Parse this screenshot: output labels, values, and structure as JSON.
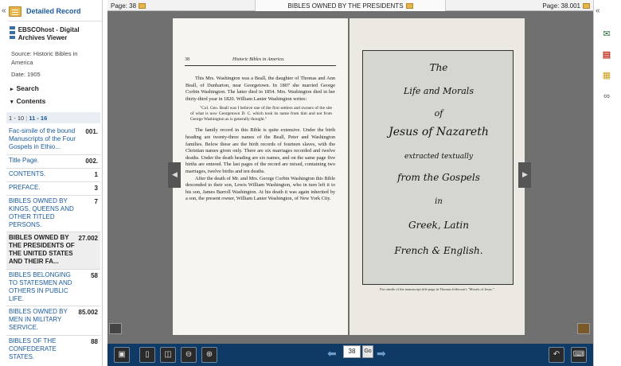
{
  "sidebar": {
    "collapse_glyph": "«",
    "title": "Detailed Record",
    "viewer_title": "EBSCOhost - Digital Archives Viewer",
    "source": "Source: Historic Bibles in America",
    "date": "Date: 1905",
    "search_label": "Search",
    "contents_label": "Contents",
    "range_current": "1 - 10",
    "range_next": "11 - 16",
    "toc": [
      {
        "label": "Fac-simile of the bound Manuscripts of the Four Gospels in Ethio...",
        "page": "001."
      },
      {
        "label": "Title Page.",
        "page": "002."
      },
      {
        "label": "CONTENTS.",
        "page": "1"
      },
      {
        "label": "PREFACE.",
        "page": "3"
      },
      {
        "label": "BIBLES OWNED BY KINGS, QUEENS AND OTHER TITLED PERSONS.",
        "page": "7"
      },
      {
        "label": "BIBLES OWNED BY THE PRESIDENTS OF THE UNITED STATES AND THEIR FA...",
        "page": "27.002"
      },
      {
        "label": "BIBLES BELONGING TO STATESMEN AND OTHERS IN PUBLIC LIFE.",
        "page": "58"
      },
      {
        "label": "BIBLES OWNED BY MEN IN MILITARY SERVICE.",
        "page": "85.002"
      },
      {
        "label": "BIBLES OF THE CONFEDERATE STATES.",
        "page": "88"
      }
    ]
  },
  "topbar": {
    "page_left": "Page: 38",
    "chapter": "BIBLES OWNED BY THE PRESIDENTS",
    "page_right": "Page: 38.001"
  },
  "left_page": {
    "number": "38",
    "header": "Historic Bibles in America.",
    "paragraphs": [
      "This Mrs. Washington was a Beall, the daughter of Thomas and Ann Beall, of Dunbarton, near Georgetown. In 1807 she married George Corbin Washington. The latter died in 1854. Mrs. Washington died in her thirty-third year in 1820. William Lanier Washington writes:",
      "The family record in this Bible is quite extensive. Under the birth heading are twenty-three names of the Beall, Peter and Washington families. Below these are the birth records of fourteen slaves, with the Christian names given only. There are six marriages recorded and twelve deaths. Under the death heading are six names, and on the same page five births are entered. The last pages of the record are mixed, containing two marriages, twelve births and ten deaths.",
      "After the death of Mr. and Mrs. George Corbin Washington this Bible descended to their son, Lewis William Washington, who in turn left it to his son, James Barroll Washington. At his death it was again inherited by a son, the present owner, William Lanier Washington, of New York City."
    ],
    "quote": "\"Col. Geo. Beall was I believe one of the first settlers and owners of the site of what is now Georgetown D. C. which took its name from him and not from George Washington as is generally thought.\""
  },
  "right_page": {
    "manuscript_lines": [
      "The",
      "Life and Morals",
      "of",
      "Jesus of Nazareth",
      "extracted textually",
      "from the Gospels",
      "in",
      "Greek, Latin",
      "French & English."
    ],
    "caption": "Fac-simile of the manuscript title page in Thomas Jefferson's \"Morals of Jesus.\""
  },
  "bottombar": {
    "page_value": "38",
    "go_label": "Go"
  }
}
